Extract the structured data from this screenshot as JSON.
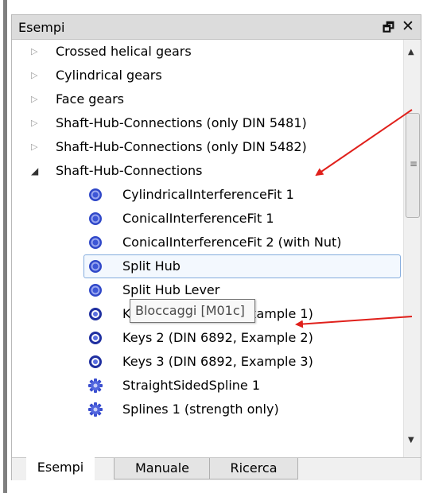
{
  "panel": {
    "title": "Esempi",
    "float_icon": "float-window-icon",
    "close_icon": "close-icon"
  },
  "tree": {
    "collapsed": [
      {
        "label": "Crossed helical gears"
      },
      {
        "label": "Cylindrical gears"
      },
      {
        "label": "Face gears"
      },
      {
        "label": "Shaft-Hub-Connections (only DIN 5481)"
      },
      {
        "label": "Shaft-Hub-Connections (only DIN 5482)"
      }
    ],
    "expanded": {
      "label": "Shaft-Hub-Connections"
    },
    "children": [
      {
        "label": "CylindricalInterferenceFit 1",
        "icon": "fit-icon"
      },
      {
        "label": "ConicalInterferenceFit 1",
        "icon": "fit-icon"
      },
      {
        "label": "ConicalInterferenceFit 2 (with Nut)",
        "icon": "fit-icon"
      },
      {
        "label": "Split Hub",
        "icon": "fit-icon",
        "selected": true
      },
      {
        "label": "Split Hub Lever",
        "icon": "fit-icon"
      },
      {
        "label": "Keys 1 (DIN 6892, Example 1)",
        "icon": "key-icon"
      },
      {
        "label": "Keys 2 (DIN 6892, Example 2)",
        "icon": "key-icon"
      },
      {
        "label": "Keys 3 (DIN 6892, Example 3)",
        "icon": "key-icon"
      },
      {
        "label": "StraightSidedSpline 1",
        "icon": "spline-gear-icon"
      },
      {
        "label": "Splines 1 (strength only)",
        "icon": "spline-gear-icon"
      }
    ]
  },
  "tooltip": {
    "text": "Bloccaggi [M01c]"
  },
  "tabs": [
    {
      "label": "Esempi",
      "active": true
    },
    {
      "label": "Manuale",
      "active": false
    },
    {
      "label": "Ricerca",
      "active": false
    }
  ],
  "colors": {
    "annotation_arrow": "#e0201b",
    "node_icon_blue": "#2f47c8",
    "selection_border": "#84acdd"
  }
}
